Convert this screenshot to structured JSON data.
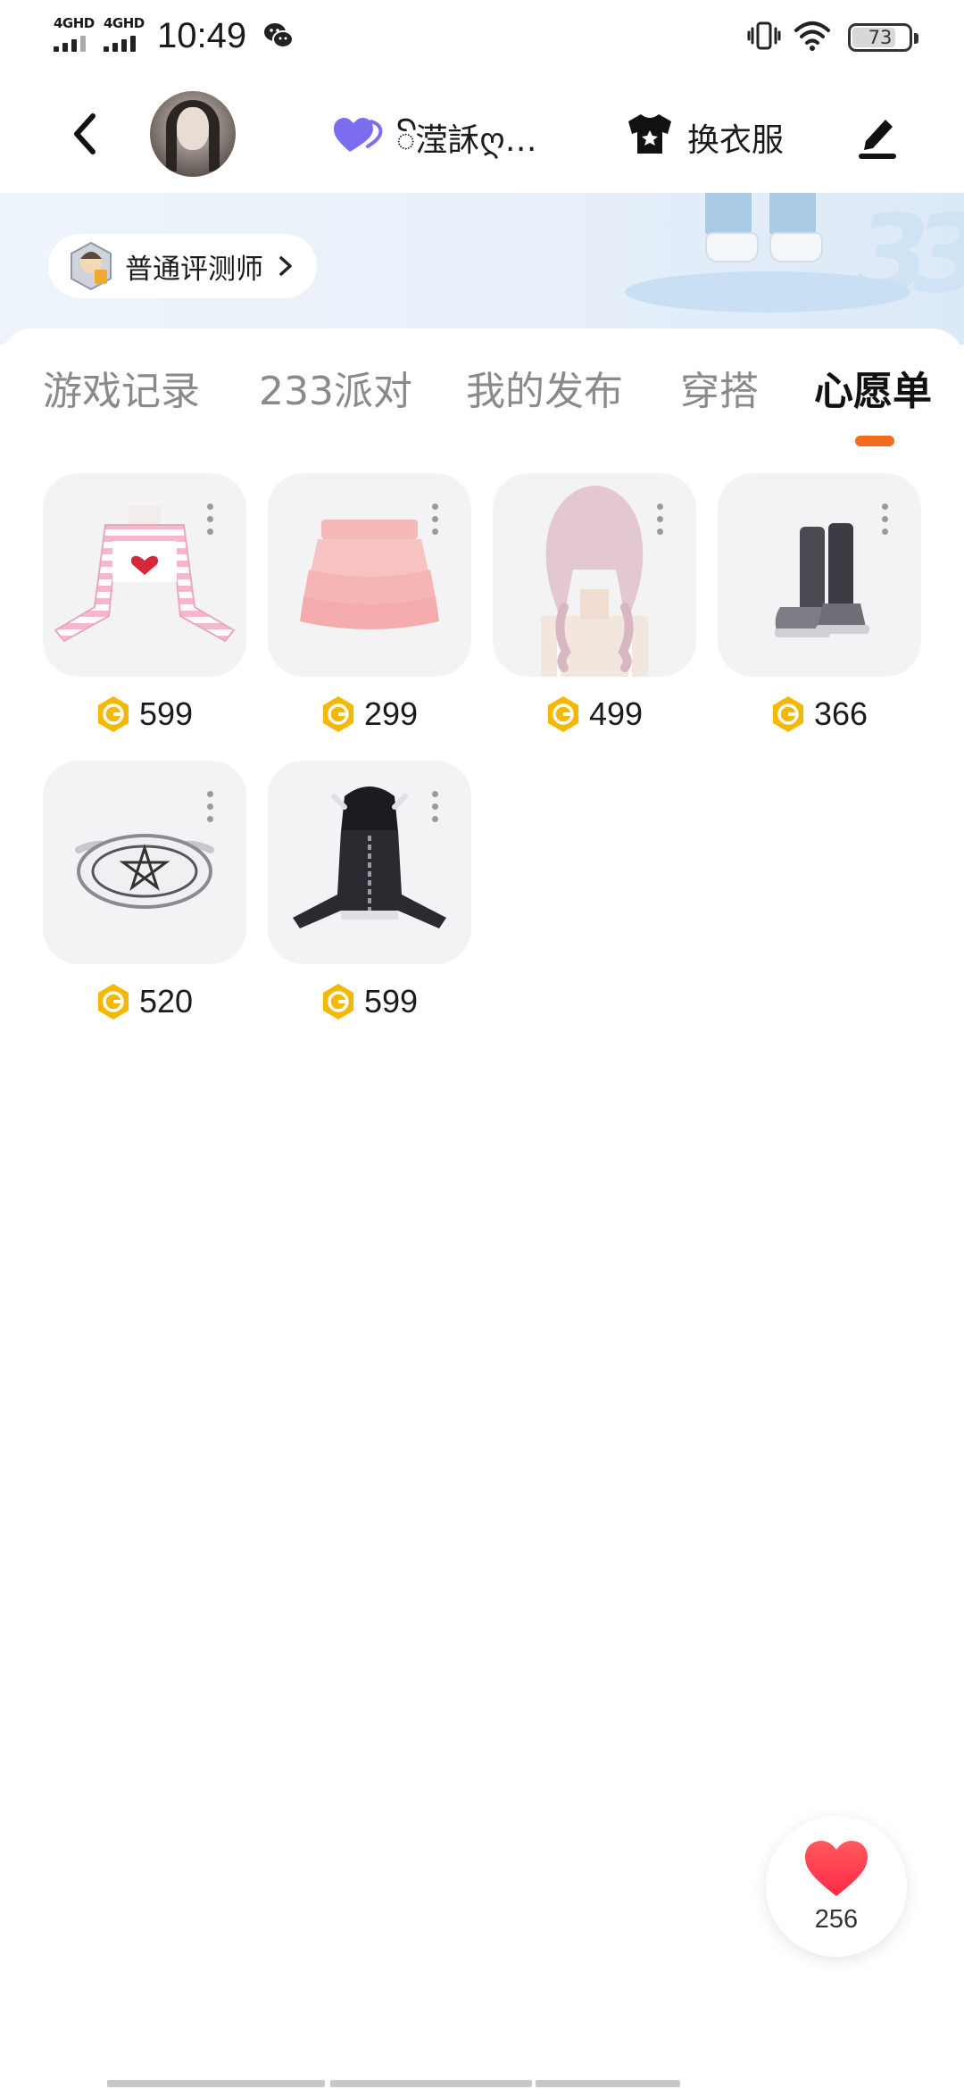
{
  "status_bar": {
    "network_1": "4GHD",
    "network_2": "4GHD",
    "time": "10:49",
    "battery": "73"
  },
  "header": {
    "username": "ꦼ滢訸ღ…",
    "dress_up_label": "换衣服"
  },
  "banner": {
    "reviewer_label": "普通评测师",
    "deco_text": "33"
  },
  "tabs": [
    {
      "label": "游戏记录",
      "active": false
    },
    {
      "label": "233派对",
      "active": false
    },
    {
      "label": "我的发布",
      "active": false
    },
    {
      "label": "穿搭",
      "active": false
    },
    {
      "label": "心愿单",
      "active": true
    }
  ],
  "wishlist": [
    {
      "item": "pink-striped-top",
      "price": "599"
    },
    {
      "item": "pink-ruffle-skirt",
      "price": "299"
    },
    {
      "item": "pink-braided-hair",
      "price": "499"
    },
    {
      "item": "black-boots",
      "price": "366"
    },
    {
      "item": "pentagram-necklace",
      "price": "520"
    },
    {
      "item": "black-hoodie",
      "price": "599"
    }
  ],
  "like": {
    "count": "256"
  },
  "colors": {
    "accent": "#f36b1c",
    "coin": "#f5b800",
    "like": "#ff3b4a",
    "badge_purple": "#7b6cf0"
  }
}
